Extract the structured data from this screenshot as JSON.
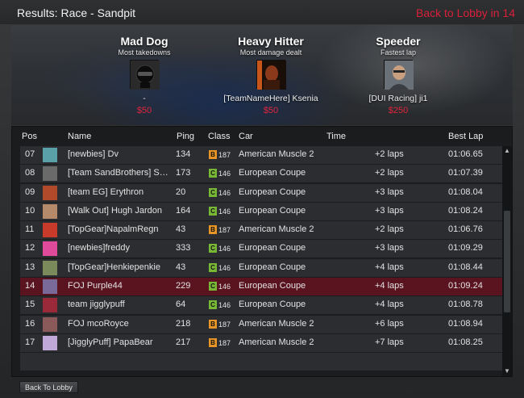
{
  "header": {
    "title": "Results: Race - Sandpit",
    "back_link": "Back to Lobby in 14"
  },
  "awards": [
    {
      "title": "Mad Dog",
      "subtitle": "Most takedowns",
      "player": "-",
      "prize": "$50",
      "avatar_icon": "helmet-icon"
    },
    {
      "title": "Heavy Hitter",
      "subtitle": "Most damage dealt",
      "player": "[TeamNameHere] Ksenia",
      "prize": "$50",
      "avatar_icon": "player-avatar"
    },
    {
      "title": "Speeder",
      "subtitle": "Fastest lap",
      "player": "[DUI Racing] ji1",
      "prize": "$250",
      "avatar_icon": "player-avatar"
    }
  ],
  "columns": {
    "pos": "Pos",
    "name": "Name",
    "ping": "Ping",
    "class": "Class",
    "car": "Car",
    "time": "Time",
    "best_lap": "Best Lap"
  },
  "rows": [
    {
      "pos": "07",
      "name": "[newbies] Dv",
      "ping": "134",
      "class_letter": "B",
      "class_num": "187",
      "car": "American Muscle 2",
      "time": "+2 laps",
      "best_lap": "01:06.65",
      "avatar_color": "#5aa0a8"
    },
    {
      "pos": "08",
      "name": "[Team SandBrothers] Sand...",
      "ping": "173",
      "class_letter": "C",
      "class_num": "146",
      "car": "European Coupe",
      "time": "+2 laps",
      "best_lap": "01:07.39",
      "avatar_color": "#6a6a6a"
    },
    {
      "pos": "09",
      "name": "[team EG] Erythron",
      "ping": "20",
      "class_letter": "C",
      "class_num": "146",
      "car": "European Coupe",
      "time": "+3 laps",
      "best_lap": "01:08.04",
      "avatar_color": "#b04a2a"
    },
    {
      "pos": "10",
      "name": "[Walk Out] Hugh Jardon",
      "ping": "164",
      "class_letter": "C",
      "class_num": "146",
      "car": "European Coupe",
      "time": "+3 laps",
      "best_lap": "01:08.24",
      "avatar_color": "#b48a6a"
    },
    {
      "pos": "11",
      "name": "[TopGear]NapalmRegn",
      "ping": "43",
      "class_letter": "B",
      "class_num": "187",
      "car": "American Muscle 2",
      "time": "+2 laps",
      "best_lap": "01:06.76",
      "avatar_color": "#c83a2a"
    },
    {
      "pos": "12",
      "name": "[newbies]freddy",
      "ping": "333",
      "class_letter": "C",
      "class_num": "146",
      "car": "European Coupe",
      "time": "+3 laps",
      "best_lap": "01:09.29",
      "avatar_color": "#e04a9a"
    },
    {
      "pos": "13",
      "name": "[TopGear]Henkiepenkie",
      "ping": "43",
      "class_letter": "C",
      "class_num": "146",
      "car": "European Coupe",
      "time": "+4 laps",
      "best_lap": "01:08.44",
      "avatar_color": "#7a8a5a"
    },
    {
      "pos": "14",
      "name": "FOJ Purple44",
      "ping": "229",
      "class_letter": "C",
      "class_num": "146",
      "car": "European Coupe",
      "time": "+4 laps",
      "best_lap": "01:09.24",
      "avatar_color": "#7a6a9a",
      "highlight": true
    },
    {
      "pos": "15",
      "name": "team jigglypuff",
      "ping": "64",
      "class_letter": "C",
      "class_num": "146",
      "car": "European Coupe",
      "time": "+4 laps",
      "best_lap": "01:08.78",
      "avatar_color": "#9a2a3a"
    },
    {
      "pos": "16",
      "name": "FOJ mcoRoyce",
      "ping": "218",
      "class_letter": "B",
      "class_num": "187",
      "car": "American Muscle 2",
      "time": "+6 laps",
      "best_lap": "01:08.94",
      "avatar_color": "#8a5a5a"
    },
    {
      "pos": "17",
      "name": "[JigglyPuff]  PapaBear",
      "ping": "217",
      "class_letter": "B",
      "class_num": "187",
      "car": "American Muscle 2",
      "time": "+7 laps",
      "best_lap": "01:08.25",
      "avatar_color": "#c0a8d8"
    }
  ],
  "footer": {
    "button_label": "Back To Lobby"
  },
  "colors": {
    "accent": "#d8203a",
    "highlight_row": "#5a1420",
    "class_b": "#e69526",
    "class_c": "#78b836"
  }
}
